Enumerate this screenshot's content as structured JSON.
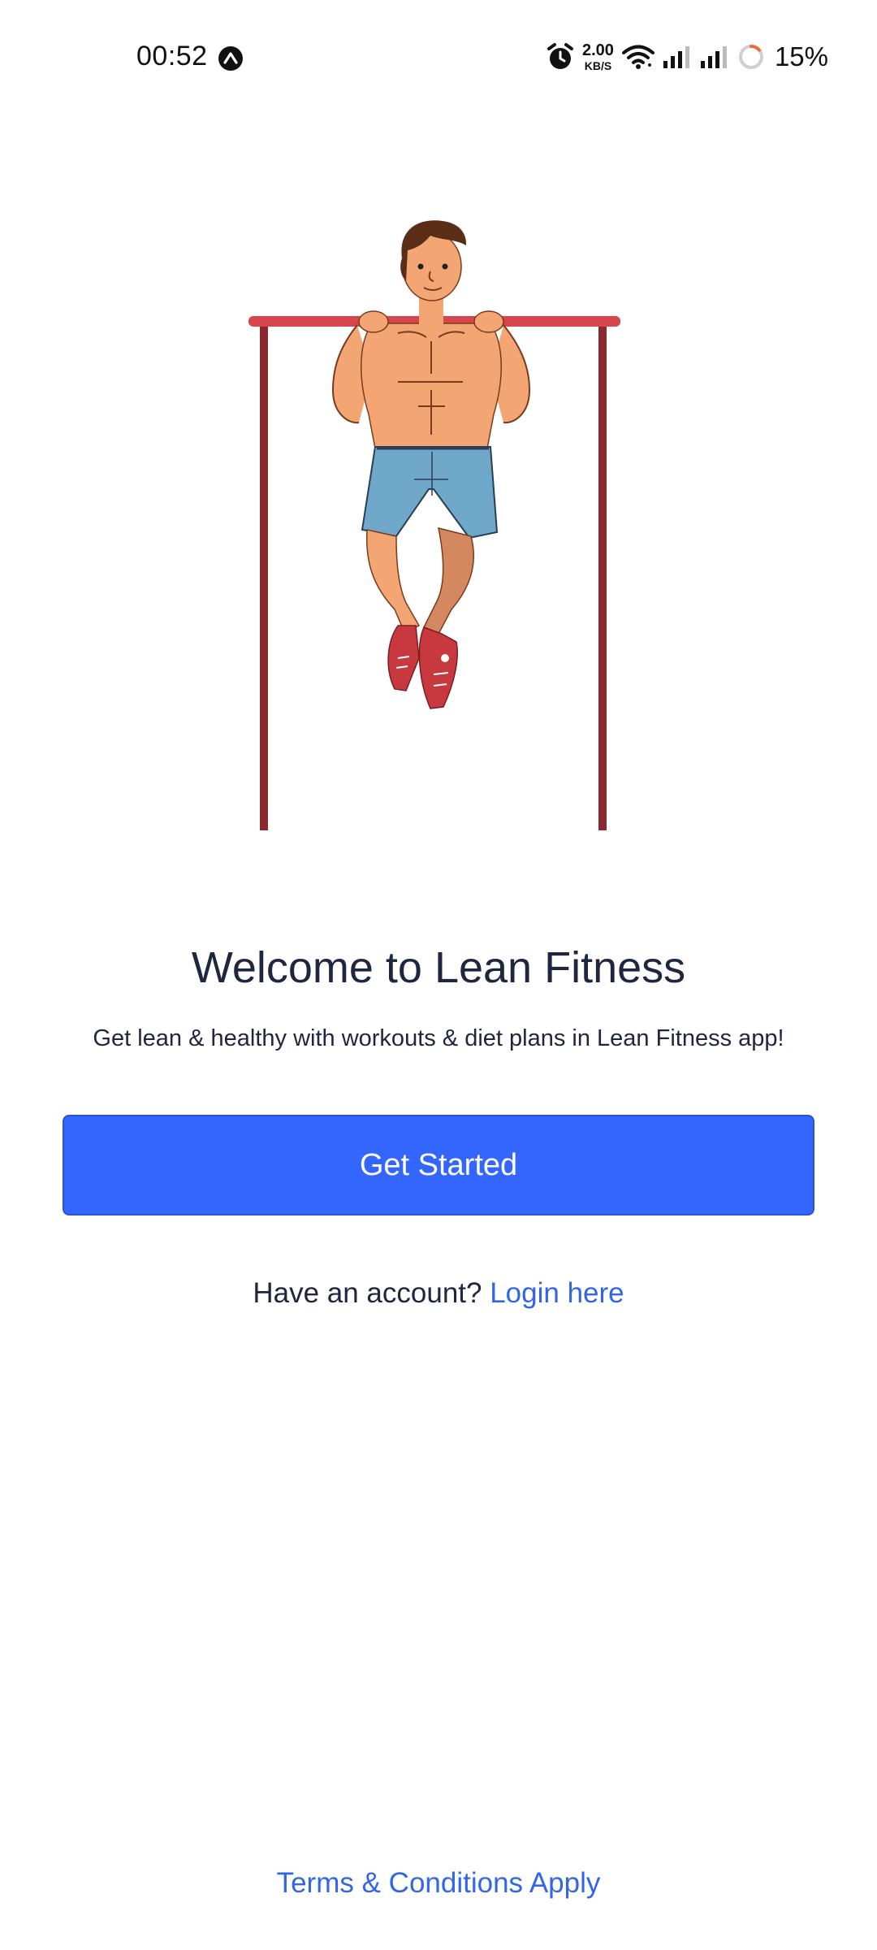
{
  "status_bar": {
    "time": "00:52",
    "net_speed_value": "2.00",
    "net_speed_unit": "KB/S",
    "battery": "15%",
    "icons": [
      "app-notification-icon",
      "alarm-icon",
      "wifi-icon",
      "signal-icon",
      "signal-icon",
      "battery-ring-icon"
    ]
  },
  "hero": {
    "illustration": "man-doing-pull-ups-illustration",
    "colors": {
      "bar": "#d9454d",
      "posts": "#8b2a2e",
      "skin": "#f3a574",
      "shorts": "#6fa8c9",
      "shoes": "#c8383f",
      "hair": "#5a2e16"
    }
  },
  "welcome": {
    "title": "Welcome to Lean Fitness",
    "subtitle": "Get lean & healthy with workouts & diet plans in Lean Fitness app!"
  },
  "actions": {
    "get_started": "Get Started",
    "have_account": "Have an account?",
    "login": "Login here"
  },
  "footer": {
    "terms": "Terms & Conditions Apply"
  },
  "colors": {
    "primary": "#3366ff",
    "link": "#3366e6",
    "text": "#1e2640"
  }
}
